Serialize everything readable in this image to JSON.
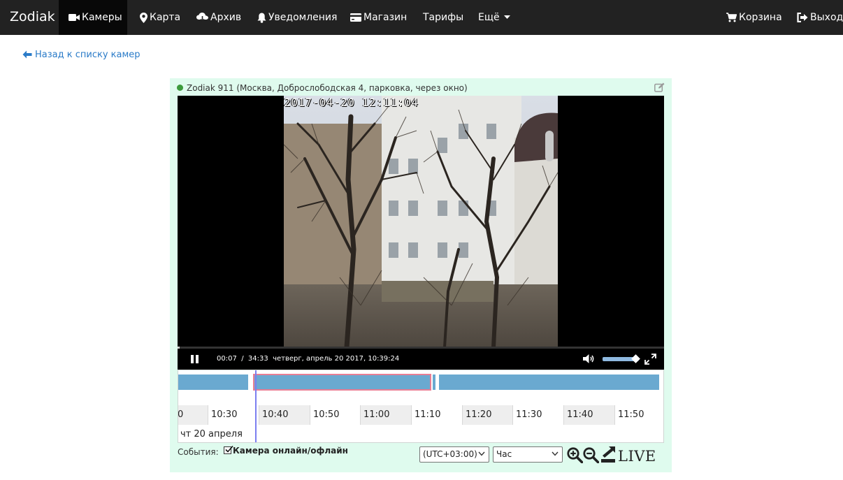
{
  "navbar": {
    "brand": "Zodiak",
    "items": [
      {
        "label": "Камеры",
        "icon": "video-camera-icon"
      },
      {
        "label": "Карта",
        "icon": "map-marker-icon"
      },
      {
        "label": "Архив",
        "icon": "cloud-download-icon"
      },
      {
        "label": "Уведомления",
        "icon": "bell-icon"
      },
      {
        "label": "Магазин",
        "icon": "credit-card-icon"
      },
      {
        "label": "Тарифы"
      },
      {
        "label": "Ещё",
        "icon": "caret-down-icon"
      }
    ],
    "active_item": "Камеры",
    "right_items": [
      {
        "label": "Корзина",
        "icon": "shopping-cart-icon"
      },
      {
        "label": "Выход",
        "icon": "sign-out-icon"
      }
    ]
  },
  "back_link": {
    "label": "Назад к списку камер",
    "icon": "arrow-left-icon"
  },
  "camera": {
    "title": "Zodiak 911 (Москва, Доброслободская 4, парковка, через окно)",
    "status": "online",
    "status_color": "#3c9a3c"
  },
  "player": {
    "video_timestamp": "2017-04-20 12:11:04",
    "elapsed": "00:07",
    "separator": "/",
    "duration": "34:33",
    "datetime_text": "четверг, апрель 20 2017, 10:39:24",
    "progress_fraction": 0.003,
    "volume_fraction": 0.9
  },
  "timeline": {
    "ticks": [
      "0",
      "10:30",
      "10:40",
      "10:50",
      "11:00",
      "11:10",
      "11:20",
      "11:30",
      "11:40",
      "11:50"
    ],
    "date_label": "чт 20 апреля",
    "segment_color": "#6aa9d0",
    "selected_outline_color": "#e87e94",
    "cursor_color": "#7b7ff0"
  },
  "events": {
    "label": "События:",
    "checkbox_label": "Камера онлайн/офлайн",
    "checked": true
  },
  "controls": {
    "timezone": "(UTC+03:00)",
    "scale": "Час",
    "live_label": "LIVE"
  },
  "colors": {
    "navbar_bg": "#222222",
    "link": "#2a7bc8",
    "panel_bg": "#dffbee"
  }
}
